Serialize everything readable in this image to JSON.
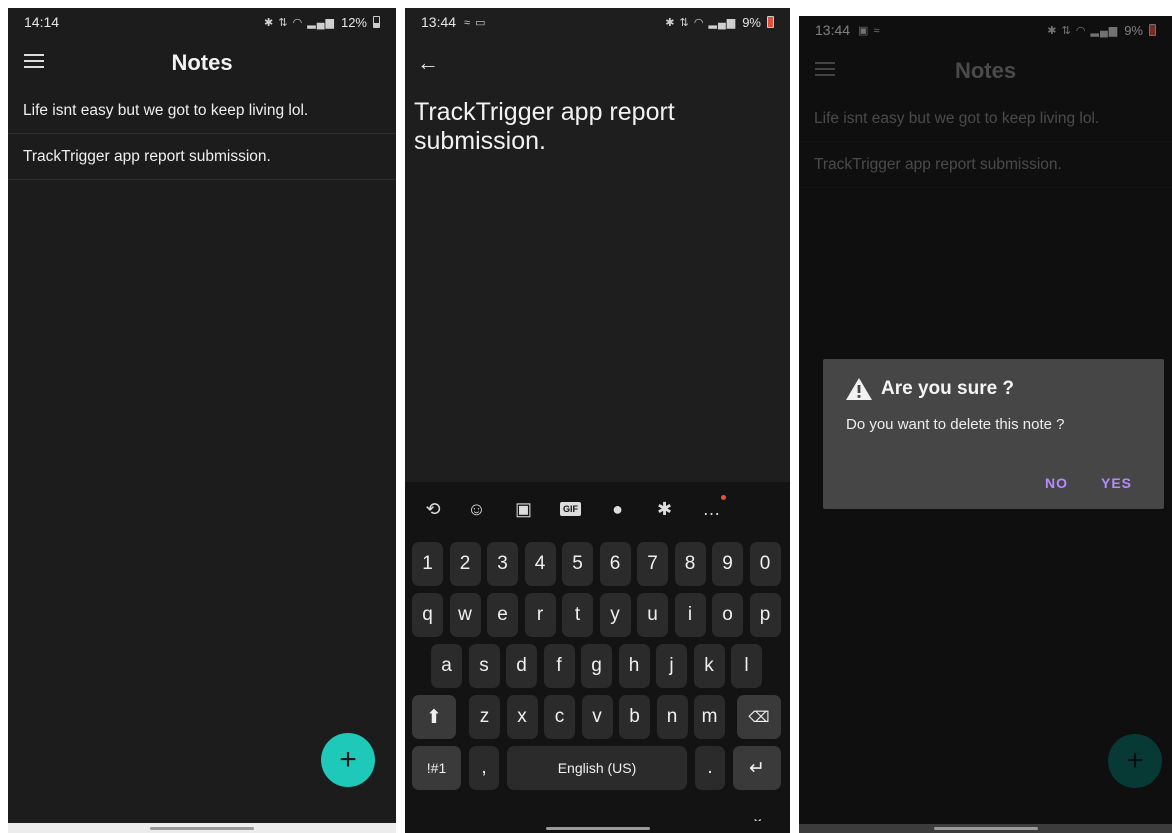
{
  "colors": {
    "background": "#1c1c1c",
    "fab": "#1ec9b9",
    "dialog_button": "#b48bff",
    "battery_low": "#e0503e"
  },
  "screen1": {
    "status": {
      "time": "14:14",
      "battery": "12%"
    },
    "title": "Notes",
    "notes": [
      "Life isnt easy but we got to keep living lol.",
      "TrackTrigger app report submission."
    ],
    "fab_label": "+",
    "menu_icon": "hamburger-icon"
  },
  "screen2": {
    "status": {
      "time": "13:44",
      "battery": "9%"
    },
    "editor_text": "TrackTrigger app report submission.",
    "back_icon": "arrow-left-icon",
    "keyboard": {
      "toolbar_icons": [
        "translate-icon",
        "emoji-icon",
        "sticker-icon",
        "gif-icon",
        "mic-icon",
        "settings-icon",
        "more-icon"
      ],
      "gif_label": "GIF",
      "row_numbers": [
        "1",
        "2",
        "3",
        "4",
        "5",
        "6",
        "7",
        "8",
        "9",
        "0"
      ],
      "row_q": [
        "q",
        "w",
        "e",
        "r",
        "t",
        "y",
        "u",
        "i",
        "o",
        "p"
      ],
      "row_a": [
        "a",
        "s",
        "d",
        "f",
        "g",
        "h",
        "j",
        "k",
        "l"
      ],
      "row_z": [
        "z",
        "x",
        "c",
        "v",
        "b",
        "n",
        "m"
      ],
      "symbols_label": "!#1",
      "comma_label": ",",
      "space_label": "English (US)",
      "period_label": "."
    }
  },
  "screen3": {
    "status": {
      "time": "13:44",
      "battery": "9%"
    },
    "title": "Notes",
    "notes": [
      "Life isnt easy but we got to keep living lol.",
      "TrackTrigger app report submission."
    ],
    "dialog": {
      "title": "Are you sure ?",
      "message": "Do you want to delete this note ?",
      "no": "NO",
      "yes": "YES"
    },
    "fab_label": "+"
  }
}
